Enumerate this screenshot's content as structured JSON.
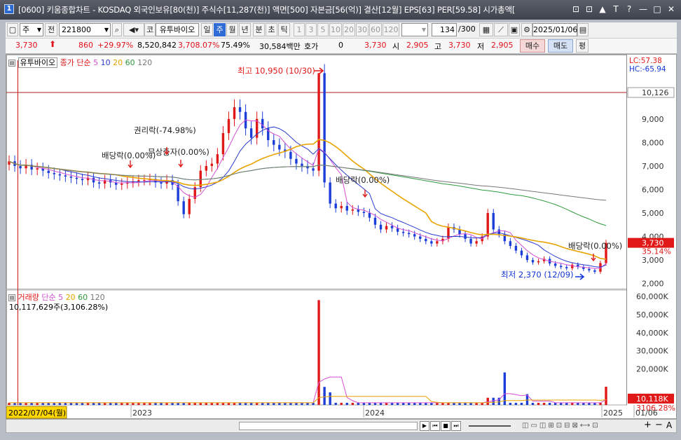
{
  "titlebar": {
    "window_number": "1",
    "title": "[0600] 키움종합차트 - KOSDAQ 외국인보유[80(천)] 주식수[11,287(천)] 액면[500] 자본금[56(억)] 결산[12월] EPS[63] PER[59.58] 시가총액[",
    "buttons": [
      "⊡",
      "⊡",
      "▲",
      "T",
      "?",
      "—",
      "□",
      "✕"
    ]
  },
  "toolbar": {
    "period_select": "주",
    "prev_label": "전",
    "code": "221800",
    "market_label": "코",
    "stock_name": "유투바이오",
    "periods": [
      "일",
      "주",
      "월",
      "년",
      "분",
      "초",
      "틱"
    ],
    "selected_period": "주",
    "intervals": [
      "1",
      "3",
      "5",
      "10",
      "20",
      "30",
      "60",
      "120"
    ],
    "count": "134",
    "count_total": "/300",
    "date": "2025/01/06"
  },
  "quote": {
    "price": "3,730",
    "change": "860",
    "change_rate": "+29.97%",
    "volume": "8,520,842",
    "volume_rate": "3,708.07%",
    "turnover": "75.49%",
    "amount": "30,584백만",
    "hoga_label": "호가",
    "hoga_value": "0",
    "hoga_price": "3,730",
    "open_label": "시",
    "open": "2,905",
    "high_label": "고",
    "high": "3,730",
    "low_label": "저",
    "low": "2,905",
    "buy": "매수",
    "sell": "매도",
    "avg": "평"
  },
  "chart_data": {
    "type": "candlestick",
    "stock_label": "유투바이오",
    "legend_main": "종가 단순",
    "ma_periods": [
      "5",
      "10",
      "20",
      "60",
      "120"
    ],
    "colors": {
      "up": "#e01818",
      "down": "#1c3ed8",
      "ma5": "#d44fd4",
      "ma10": "#2b3bd0",
      "ma20": "#e8a400",
      "ma60": "#2e9a3c",
      "ma120": "#777777"
    },
    "lc": "LC:57.38",
    "hc": "HC:-65.94",
    "price_axis": [
      "10,126",
      "9,000",
      "8,000",
      "7,000",
      "6,000",
      "5,000",
      "4,000",
      "3,730",
      "35.14%",
      "3,000",
      "2,000"
    ],
    "price_ylim": [
      1900,
      11200
    ],
    "ref_line": 10126,
    "annotations": {
      "high": "최고 10,950 (10/30)",
      "low": "최저 2,370 (12/09)",
      "div1": "배당락(0.00%)",
      "rights": "권리락(-74.98%)",
      "bonus": "무상증자(0.00%)",
      "div2": "배당락(0.00%)",
      "div3": "배당락(0.00%)"
    },
    "volume_legend": "거래량",
    "volume_legend_ma": "단순",
    "volume_ma": [
      "5",
      "20",
      "60",
      "120"
    ],
    "volume_info": "10,117,629주(3,106.28%)",
    "volume_axis": [
      "60,000K",
      "50,000K",
      "40,000K",
      "30,000K",
      "20,000K",
      "10,000K",
      "10,118K",
      "3106.28%"
    ],
    "volume_ylim": [
      0,
      62000
    ],
    "x_labels": [
      "2022/07/04(월)",
      "2023",
      "2024",
      "2025",
      "01/06"
    ],
    "weekly_close": [
      7200,
      7000,
      6900,
      7050,
      6850,
      6900,
      6800,
      6700,
      6650,
      6600,
      6550,
      6500,
      6450,
      6400,
      6500,
      6300,
      6250,
      6400,
      6300,
      6200,
      6250,
      6300,
      6350,
      6400,
      6400,
      6450,
      6300,
      6250,
      6400,
      6200,
      5500,
      4950,
      5600,
      6100,
      6800,
      7000,
      7100,
      7500,
      8400,
      9000,
      9500,
      9300,
      8600,
      8200,
      9000,
      8600,
      8100,
      7900,
      7700,
      7600,
      7300,
      7100,
      7000,
      6900,
      6800,
      10950,
      6300,
      5400,
      5200,
      5300,
      5100,
      5150,
      5050,
      5000,
      4800,
      4500,
      4300,
      4450,
      4350,
      4200,
      4150,
      4100,
      4000,
      3900,
      3800,
      3700,
      3800,
      3900,
      4400,
      4300,
      4100,
      3900,
      3700,
      3800,
      4000,
      5000,
      4300,
      4100,
      3800,
      3600,
      3400,
      3200,
      3000,
      2900,
      2950,
      3050,
      2850,
      2750,
      2700,
      2650,
      2800,
      2700,
      2620,
      2560,
      2500,
      2870,
      3730
    ]
  },
  "bottombar": {
    "controls": [
      "▶",
      "⏮",
      "■",
      "⏭",
      "+",
      "−",
      "A"
    ]
  }
}
